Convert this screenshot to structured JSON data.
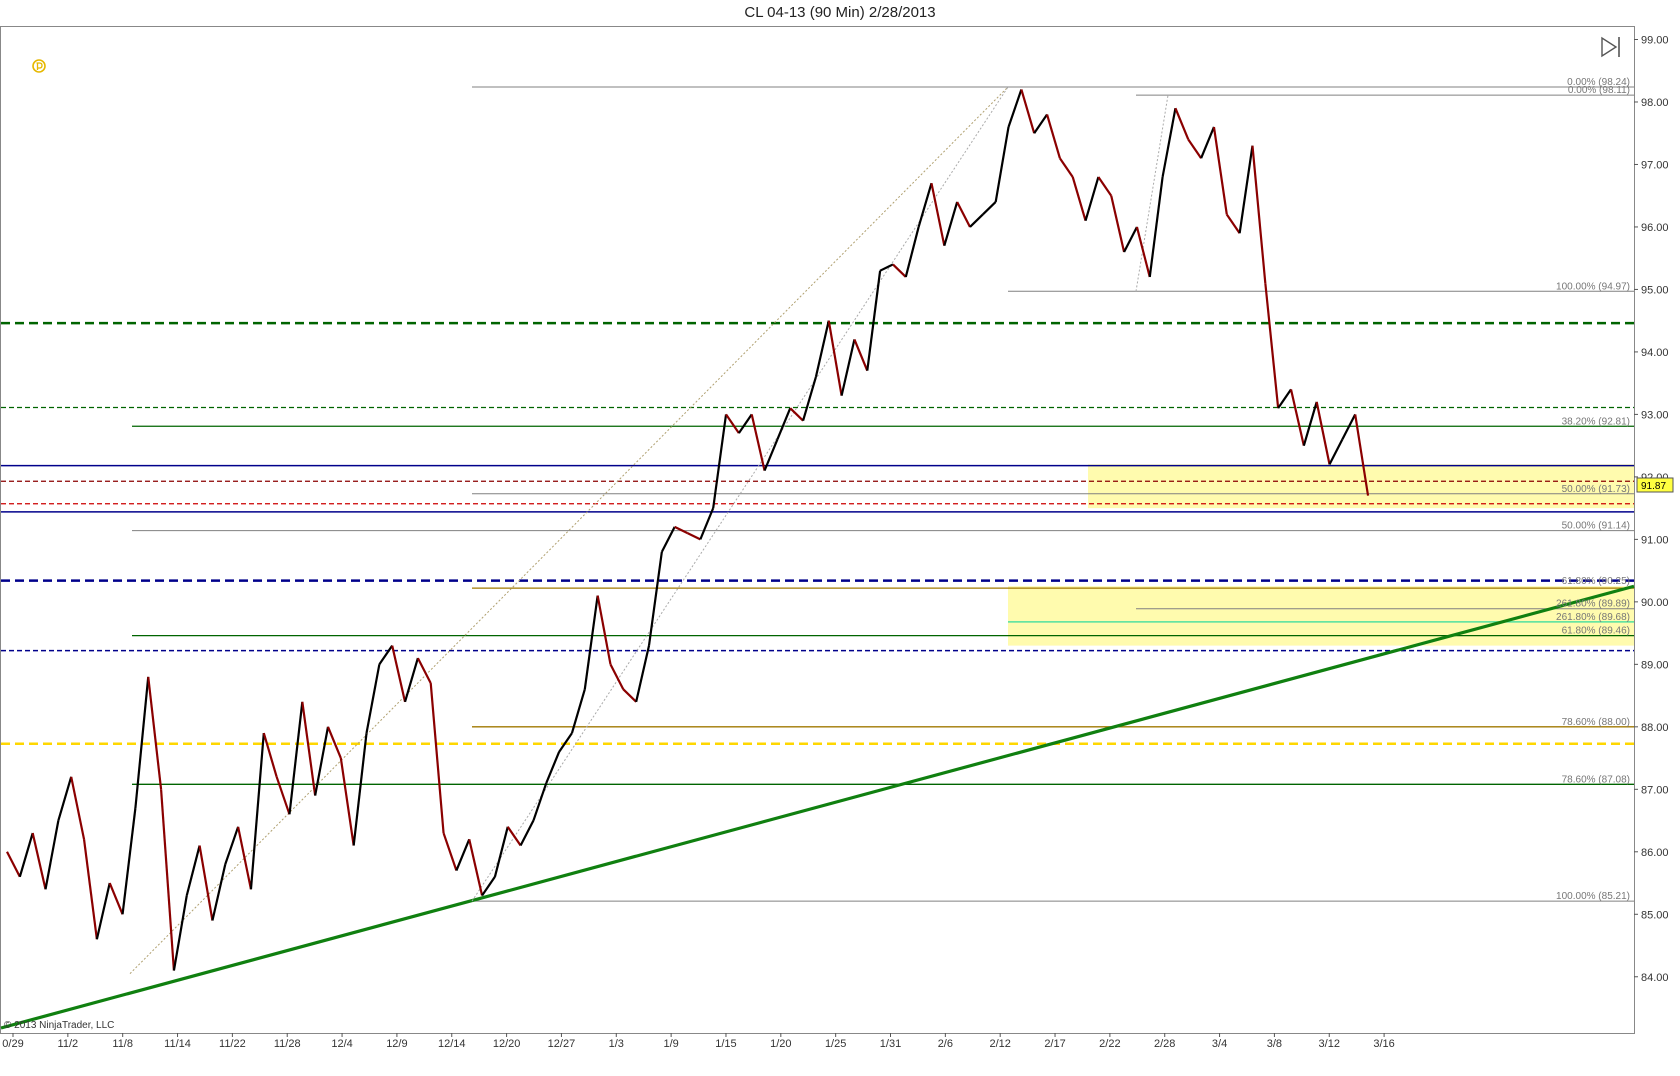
{
  "window": {
    "title": "CL 04-13 (90 Min)  2/28/2013"
  },
  "chart_data": {
    "type": "line",
    "title": "CL 04-13 (90 Min)  2/28/2013",
    "xlabel": "",
    "ylabel": "",
    "ylim": [
      83.1,
      99.2
    ],
    "grid": false,
    "copyright": "© 2013 NinjaTrader, LLC",
    "last_price": "91.87",
    "x_ticks": [
      "0/29",
      "11/2",
      "11/8",
      "11/14",
      "11/22",
      "11/28",
      "12/4",
      "12/9",
      "12/14",
      "12/20",
      "12/27",
      "1/3",
      "1/9",
      "1/15",
      "1/20",
      "1/25",
      "1/31",
      "2/6",
      "2/12",
      "2/17",
      "2/22",
      "2/28",
      "3/4",
      "3/8",
      "3/12",
      "3/16"
    ],
    "y_ticks": [
      "84.00",
      "85.00",
      "86.00",
      "87.00",
      "88.00",
      "89.00",
      "90.00",
      "91.00",
      "92.00",
      "93.00",
      "94.00",
      "95.00",
      "96.00",
      "97.00",
      "98.00",
      "99.00"
    ],
    "price_path": [
      [
        0,
        86.0
      ],
      [
        1,
        85.6
      ],
      [
        2,
        86.3
      ],
      [
        3,
        85.4
      ],
      [
        4,
        86.5
      ],
      [
        5,
        87.2
      ],
      [
        6,
        86.2
      ],
      [
        7,
        84.6
      ],
      [
        8,
        85.5
      ],
      [
        9,
        85.0
      ],
      [
        10,
        86.7
      ],
      [
        11,
        88.8
      ],
      [
        12,
        87.0
      ],
      [
        13,
        84.1
      ],
      [
        14,
        85.3
      ],
      [
        15,
        86.1
      ],
      [
        16,
        84.9
      ],
      [
        17,
        85.8
      ],
      [
        18,
        86.4
      ],
      [
        19,
        85.4
      ],
      [
        20,
        87.9
      ],
      [
        21,
        87.2
      ],
      [
        22,
        86.6
      ],
      [
        23,
        88.4
      ],
      [
        24,
        86.9
      ],
      [
        25,
        88.0
      ],
      [
        26,
        87.5
      ],
      [
        27,
        86.1
      ],
      [
        28,
        87.9
      ],
      [
        29,
        89.0
      ],
      [
        30,
        89.3
      ],
      [
        31,
        88.4
      ],
      [
        32,
        89.1
      ],
      [
        33,
        88.7
      ],
      [
        34,
        86.3
      ],
      [
        35,
        85.7
      ],
      [
        36,
        86.2
      ],
      [
        37,
        85.3
      ],
      [
        38,
        85.6
      ],
      [
        39,
        86.4
      ],
      [
        40,
        86.1
      ],
      [
        41,
        86.5
      ],
      [
        42,
        87.1
      ],
      [
        43,
        87.6
      ],
      [
        44,
        87.9
      ],
      [
        45,
        88.6
      ],
      [
        46,
        90.1
      ],
      [
        47,
        89.0
      ],
      [
        48,
        88.6
      ],
      [
        49,
        88.4
      ],
      [
        50,
        89.3
      ],
      [
        51,
        90.8
      ],
      [
        52,
        91.2
      ],
      [
        53,
        91.1
      ],
      [
        54,
        91.0
      ],
      [
        55,
        91.5
      ],
      [
        56,
        93.0
      ],
      [
        57,
        92.7
      ],
      [
        58,
        93.0
      ],
      [
        59,
        92.1
      ],
      [
        60,
        92.6
      ],
      [
        61,
        93.1
      ],
      [
        62,
        92.9
      ],
      [
        63,
        93.6
      ],
      [
        64,
        94.5
      ],
      [
        65,
        93.3
      ],
      [
        66,
        94.2
      ],
      [
        67,
        93.7
      ],
      [
        68,
        95.3
      ],
      [
        69,
        95.4
      ],
      [
        70,
        95.2
      ],
      [
        71,
        96.0
      ],
      [
        72,
        96.7
      ],
      [
        73,
        95.7
      ],
      [
        74,
        96.4
      ],
      [
        75,
        96.0
      ],
      [
        76,
        96.2
      ],
      [
        77,
        96.4
      ],
      [
        78,
        97.6
      ],
      [
        79,
        98.2
      ],
      [
        80,
        97.5
      ],
      [
        81,
        97.8
      ],
      [
        82,
        97.1
      ],
      [
        83,
        96.8
      ],
      [
        84,
        96.1
      ],
      [
        85,
        96.8
      ],
      [
        86,
        96.5
      ],
      [
        87,
        95.6
      ],
      [
        88,
        96.0
      ],
      [
        89,
        95.2
      ],
      [
        90,
        96.8
      ],
      [
        91,
        97.9
      ],
      [
        92,
        97.4
      ],
      [
        93,
        97.1
      ],
      [
        94,
        97.6
      ],
      [
        95,
        96.2
      ],
      [
        96,
        95.9
      ],
      [
        97,
        97.3
      ],
      [
        98,
        95.1
      ],
      [
        99,
        93.1
      ],
      [
        100,
        93.4
      ],
      [
        101,
        92.5
      ],
      [
        102,
        93.2
      ],
      [
        103,
        92.2
      ],
      [
        104,
        92.6
      ],
      [
        105,
        93.0
      ],
      [
        106,
        91.7
      ]
    ],
    "extra_labels_hidden_note": "",
    "fib_labels": [
      {
        "text": "0.00% (98.24)",
        "y": 98.24
      },
      {
        "text": "0.00% (98.11)",
        "y": 98.11
      },
      {
        "text": "100.00% (94.97)",
        "y": 94.97
      },
      {
        "text": "38.20% (92.81)",
        "y": 92.81
      },
      {
        "text": "50.00% (91.73)",
        "y": 91.73
      },
      {
        "text": "50.00% (91.14)",
        "y": 91.14
      },
      {
        "text": "61.80% (90.25)",
        "y": 90.25
      },
      {
        "text": "261.80% (89.89)",
        "y": 89.89
      },
      {
        "text": "261.80% (89.68)",
        "y": 89.68
      },
      {
        "text": "61.80% (89.46)",
        "y": 89.46
      },
      {
        "text": "78.60% (88.00)",
        "y": 88.0
      },
      {
        "text": "78.60% (87.08)",
        "y": 87.08
      },
      {
        "text": "100.00% (85.21)",
        "y": 85.21
      }
    ],
    "colors": {
      "fib_gray": "#808080",
      "fib_green": "#006400",
      "fib_brown": "#a07800",
      "channel_blue": "#00008b",
      "dashed_red": "#cc0000",
      "dashed_darkred": "#8b0000",
      "dashed_gold": "#ffd700",
      "dashed_green": "#006400",
      "trendline_green": "#108010",
      "zone_yellow": "#fffaa0",
      "candle_up": "#000000",
      "candle_down": "#8b0000"
    }
  }
}
